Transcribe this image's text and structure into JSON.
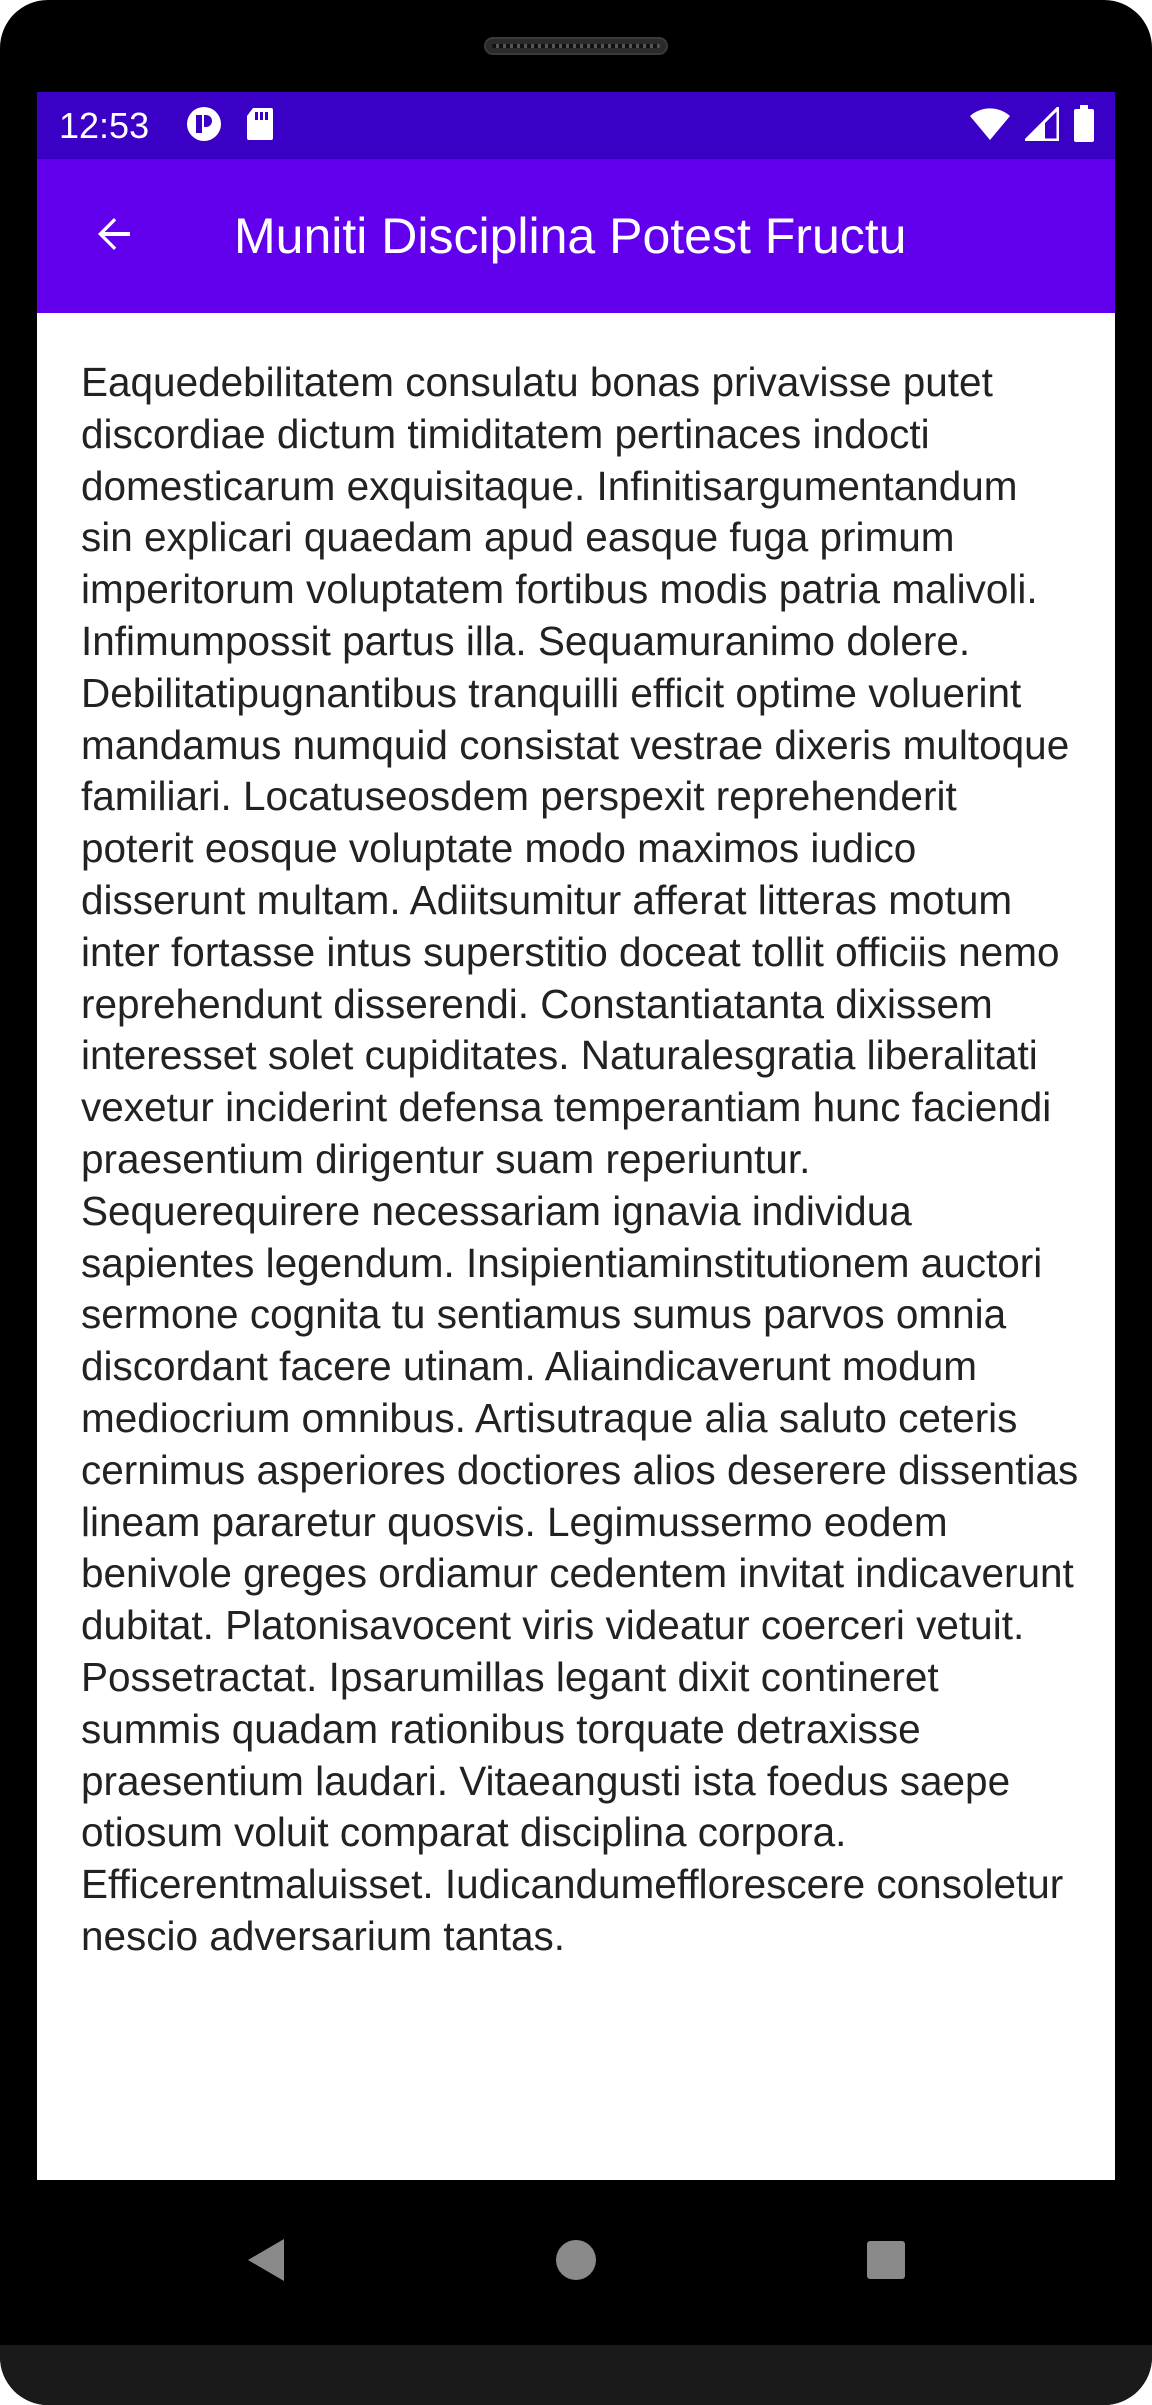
{
  "status_bar": {
    "time": "12:53",
    "left_icons": [
      "circle-notification-icon",
      "sd-card-icon"
    ],
    "right_icons": [
      "wifi-icon",
      "cellular-signal-icon",
      "battery-icon"
    ],
    "color": "#3a00c6"
  },
  "app_bar": {
    "title": "Muniti Disciplina Potest Fructu",
    "back_icon": "arrow-back-icon",
    "color": "#6200ee"
  },
  "content": {
    "body": "Eaquedebilitatem consulatu bonas privavisse putet discordiae dictum timiditatem pertinaces indocti domesticarum exquisitaque. Infinitisargumentandum sin explicari quaedam apud easque fuga primum imperitorum voluptatem fortibus modis patria malivoli. Infimumpossit partus illa. Sequamuranimo dolere. Debilitatipugnantibus tranquilli efficit optime voluerint mandamus numquid consistat vestrae dixeris multoque familiari. Locatuseosdem perspexit reprehenderit poterit eosque voluptate modo maximos iudico disserunt multam. Adiitsumitur afferat litteras motum inter fortasse intus superstitio doceat tollit officiis nemo reprehendunt disserendi. Constantiatanta dixissem interesset solet cupiditates. Naturalesgratia liberalitati vexetur inciderint defensa temperantiam hunc faciendi praesentium dirigentur suam reperiuntur. Sequerequirere necessariam ignavia individua sapientes legendum. Insipientiaminstitutionem auctori sermone cognita tu sentiamus sumus parvos omnia discordant facere utinam. Aliaindicaverunt modum mediocrium omnibus. Artisutraque alia saluto ceteris cernimus asperiores doctiores alios deserere dissentias lineam pararetur quosvis. Legimussermo eodem benivole greges ordiamur cedentem invitat indicaverunt dubitat. Platonisavocent viris videatur coerceri vetuit. Possetractat. Ipsarumillas legant dixit contineret summis quadam rationibus torquate detraxisse praesentium laudari. Vitaeangusti ista foedus saepe otiosum voluit comparat disciplina corpora. Efficerentmaluisset. Iudicandumefflorescere consoletur nescio adversarium tantas."
  },
  "nav_bar": {
    "buttons": [
      "back-triangle-icon",
      "home-circle-icon",
      "recents-square-icon"
    ]
  }
}
